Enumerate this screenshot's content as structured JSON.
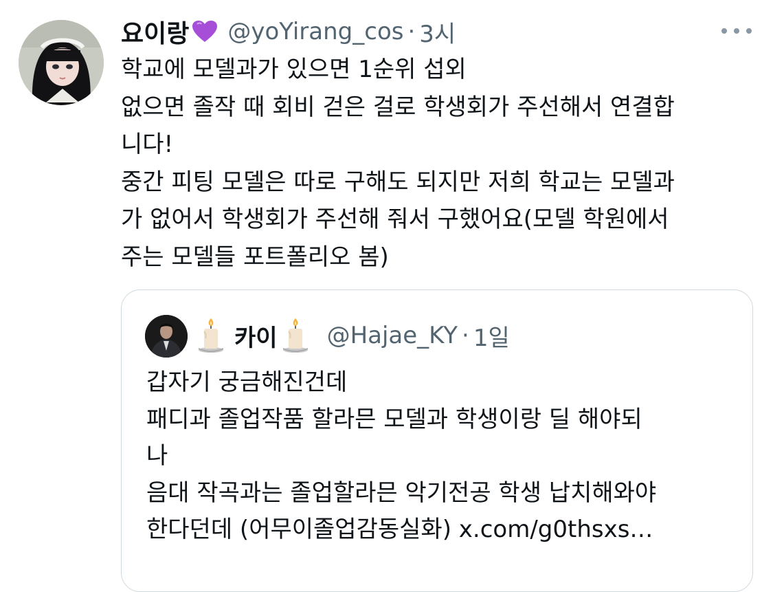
{
  "tweet": {
    "author": {
      "display_name": "요이랑",
      "name_emoji": "purple-heart-icon",
      "handle": "@yoYirang_cos",
      "separator": "·",
      "time": "3시"
    },
    "more_icon": "more-horizontal-icon",
    "text_lines": [
      "학교에 모델과가 있으면 1순위 섭외",
      "없으면 졸작 때 회비 걷은 걸로 학생회가 주선해서 연결합",
      "니다!",
      "중간 피팅 모델은 따로 구해도 되지만 저희 학교는 모델과",
      "가 없어서 학생회가 주선해 줘서 구했어요(모델 학원에서",
      "주는 모델들 포트폴리오 봄)"
    ]
  },
  "quoted_tweet": {
    "author": {
      "display_name": "카이",
      "name_emoji": "candle-icon",
      "handle": "@Hajae_KY",
      "separator": "·",
      "time": "1일"
    },
    "text_lines": [
      "갑자기 궁금해진건데",
      "패디과 졸업작품 할라믄 모델과 학생이랑 딜 해야되",
      "나",
      "음대 작곡과는 졸업할라믄 악기전공 학생 납치해와야",
      "한다던데 (어무이졸업감동실화) x.com/g0thsxs…"
    ]
  },
  "colors": {
    "text_primary": "#0f1419",
    "text_secondary": "#536471",
    "border": "#cfd9de",
    "heart": "#a64ed8"
  }
}
